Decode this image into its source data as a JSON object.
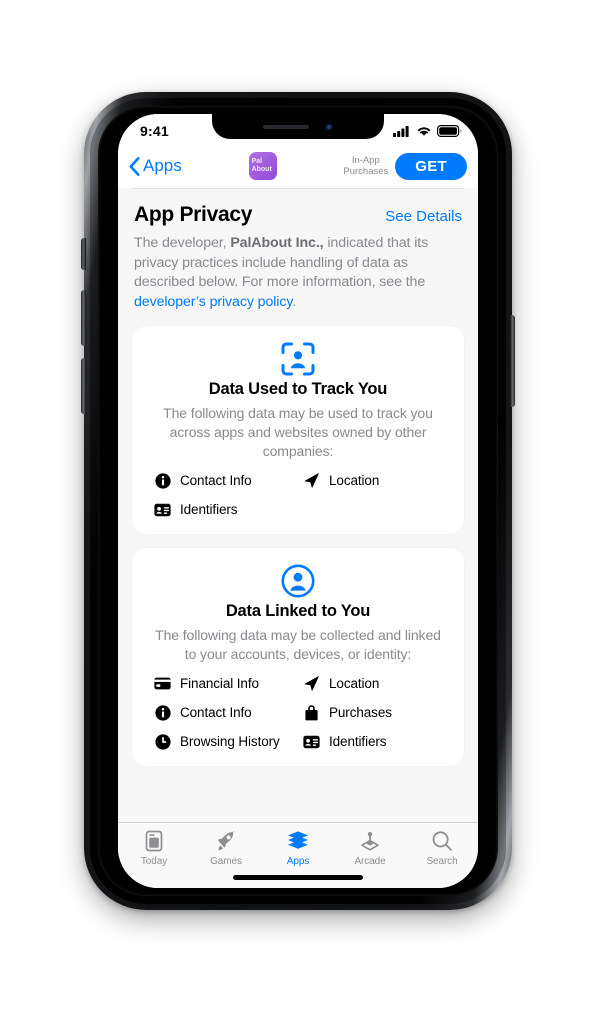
{
  "status_bar": {
    "time": "9:41",
    "icons": [
      "cellular-signal-icon",
      "wifi-icon",
      "battery-icon"
    ]
  },
  "nav_bar": {
    "back_label": "Apps",
    "back_icon": "chevron-left-icon",
    "app_icon_line1": "Pal",
    "app_icon_line2": "About",
    "in_app_line1": "In-App",
    "in_app_line2": "Purchases",
    "get_label": "GET"
  },
  "section": {
    "title": "App Privacy",
    "see_details_label": "See Details",
    "blurb_part1": "The developer, ",
    "blurb_developer": "PalAbout Inc.,",
    "blurb_part2": " indicated that its privacy practices include handling of data as described below. For more information, see the ",
    "blurb_link": "developer’s privacy policy",
    "blurb_part3": "."
  },
  "cards": [
    {
      "icon": "person-in-viewfinder-icon",
      "title": "Data Used to Track You",
      "subtitle": "The following data may be used to track you across apps and websites owned by other companies:",
      "items": [
        {
          "icon": "info-circle-icon",
          "label": "Contact Info"
        },
        {
          "icon": "location-arrow-icon",
          "label": "Location"
        },
        {
          "icon": "identification-card-icon",
          "label": "Identifiers"
        }
      ]
    },
    {
      "icon": "person-circle-icon",
      "title": "Data Linked to You",
      "subtitle": "The following data may be collected and linked to your accounts, devices, or identity:",
      "items": [
        {
          "icon": "credit-card-icon",
          "label": "Financial Info"
        },
        {
          "icon": "location-arrow-icon",
          "label": "Location"
        },
        {
          "icon": "info-circle-icon",
          "label": "Contact Info"
        },
        {
          "icon": "shopping-bag-icon",
          "label": "Purchases"
        },
        {
          "icon": "clock-icon",
          "label": "Browsing History"
        },
        {
          "icon": "identification-card-icon",
          "label": "Identifiers"
        }
      ]
    }
  ],
  "tab_bar": {
    "tabs": [
      {
        "icon": "today-document-icon",
        "label": "Today",
        "active": false
      },
      {
        "icon": "rocket-icon",
        "label": "Games",
        "active": false
      },
      {
        "icon": "stacked-layers-icon",
        "label": "Apps",
        "active": true
      },
      {
        "icon": "arcade-joystick-icon",
        "label": "Arcade",
        "active": false
      },
      {
        "icon": "magnifier-icon",
        "label": "Search",
        "active": false
      }
    ]
  },
  "colors": {
    "accent_blue": "#007aff",
    "secondary_text": "#8a8a8e",
    "tab_inactive": "#8e8e93",
    "screen_bg": "#f7f7f7",
    "card_bg": "#ffffff",
    "app_icon_purple": "#a45ee0"
  }
}
